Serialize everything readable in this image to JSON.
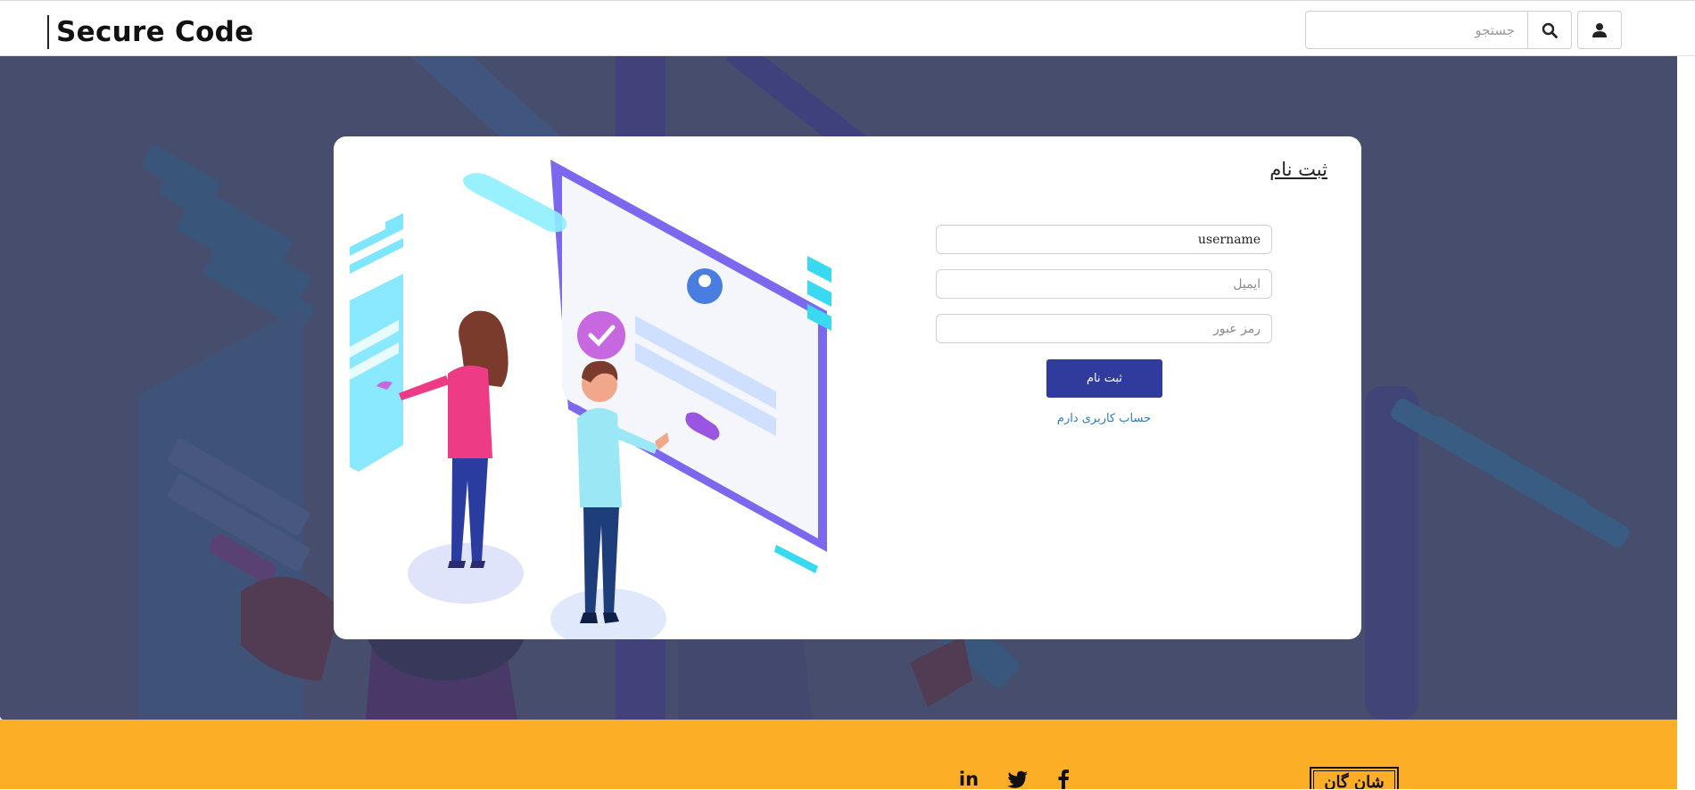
{
  "header": {
    "brand": "Secure Code",
    "search_placeholder": "جستجو",
    "search_icon": "search-icon",
    "user_icon": "user-icon"
  },
  "signup_card": {
    "title": "ثبت نام",
    "username_value": "username",
    "email_placeholder": "ایمیل",
    "password_placeholder": "رمز عبور",
    "submit_label": "ثبت نام",
    "login_link": "حساب کاربری دارم",
    "illustration": "two-people-account-verification-illustration"
  },
  "footer": {
    "social_icons": [
      "linkedin-icon",
      "twitter-icon",
      "facebook-icon"
    ],
    "linkedin_glyph": "in",
    "logo_text": "شان گان"
  },
  "colors": {
    "hero_bg": "#474d6d",
    "primary_button": "#2f3c9e",
    "link": "#2d7bc4",
    "footer_bg": "#fcaf26"
  }
}
